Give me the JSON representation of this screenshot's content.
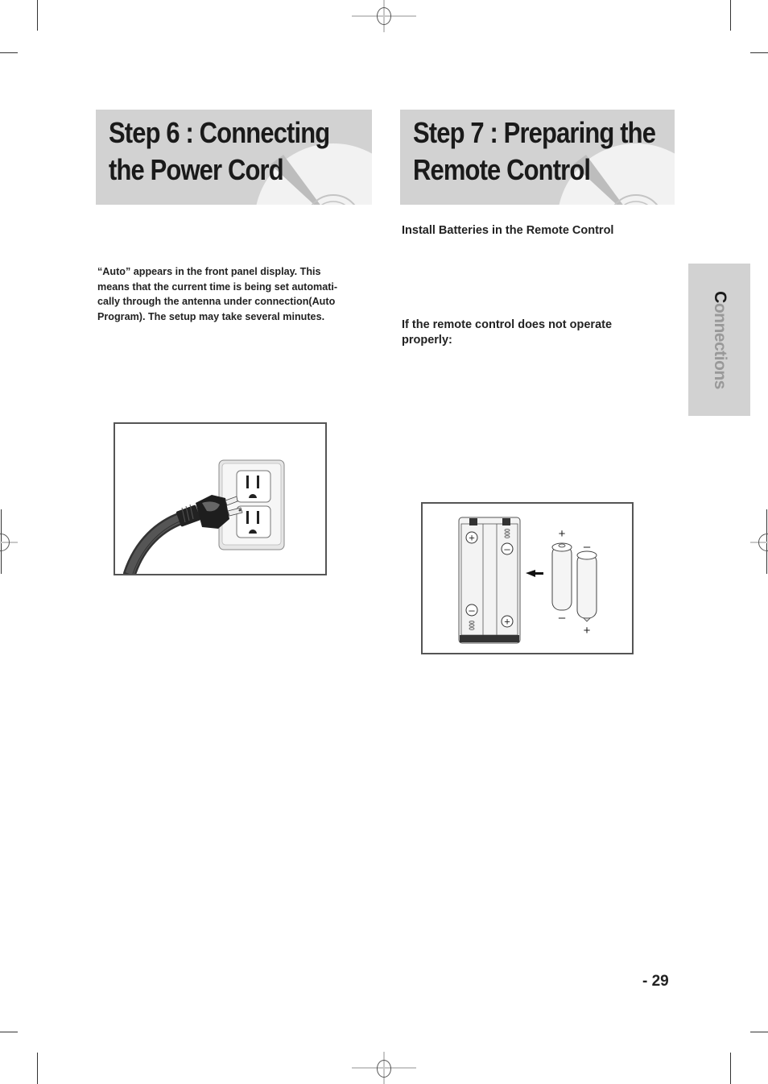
{
  "section_tab": {
    "label_first": "C",
    "label_rest": "onnections"
  },
  "step6": {
    "title_line1": "Step 6 : Connecting",
    "title_line2": "the Power Cord",
    "note": "“Auto” appears in the front panel display. This means that the current time is being set automatically through the antenna under connection(Auto Program). The setup may take several minutes.",
    "note_lines": [
      "“Auto” appears in the front panel display. This",
      "means that the current time is being set automati-",
      "cally through the antenna under connection(Auto",
      "Program). The setup may take several minutes."
    ],
    "figure": "power-plug-into-wall-outlet"
  },
  "step7": {
    "title_line1": "Step 7 : Preparing the",
    "title_line2": "Remote Control",
    "install_heading": "Install Batteries in the Remote Control",
    "trouble_heading": "If the remote control does not operate properly:",
    "figure": "battery-compartment-with-two-aa-batteries",
    "polarity_labels": {
      "plus": "+",
      "minus": "–"
    }
  },
  "footer": {
    "page_number": "- 29"
  },
  "colors": {
    "header_band": "#d2d2d2",
    "title_text": "#1a1a1a",
    "tab_label": "#999999"
  }
}
